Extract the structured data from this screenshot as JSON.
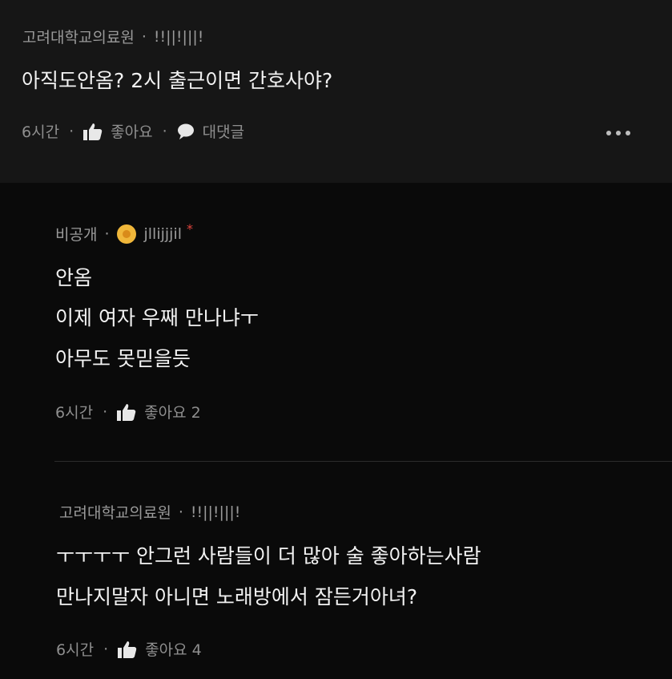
{
  "post": {
    "author": "고려대학교의료원",
    "author_suffix": "!!||!|||!",
    "text": "아직도안옴? 2시 출근이면 간호사야?",
    "time": "6시간",
    "like_label": "좋아요",
    "comment_label": "대댓글"
  },
  "replies": [
    {
      "visibility": "비공개",
      "username": "jllijjjil",
      "star": "*",
      "lines": [
        "안옴",
        "이제 여자 우째 만나냐ㅜ",
        "아무도 못믿을듯"
      ],
      "time": "6시간",
      "like_label": "좋아요 2"
    },
    {
      "author": "고려대학교의료원",
      "author_suffix": "!!||!|||!",
      "lines": [
        "ㅜㅜㅜㅜ 안그런 사람들이 더 많아 술 좋아하는사람",
        "만나지말자 아니면 노래방에서 잠든거아녀?"
      ],
      "time": "6시간",
      "like_label": "좋아요 4"
    }
  ],
  "icons": {
    "like": "thumbs-up-icon",
    "comment": "speech-bubble-icon",
    "more": "more-dots-icon",
    "avatar": "yellow-avatar-icon"
  },
  "colors": {
    "background": "#0a0a0a",
    "post_background": "#161616",
    "text": "#f2f2f2",
    "meta": "#9a9a9a",
    "star": "#e0443e",
    "avatar": "#f0b73a"
  }
}
